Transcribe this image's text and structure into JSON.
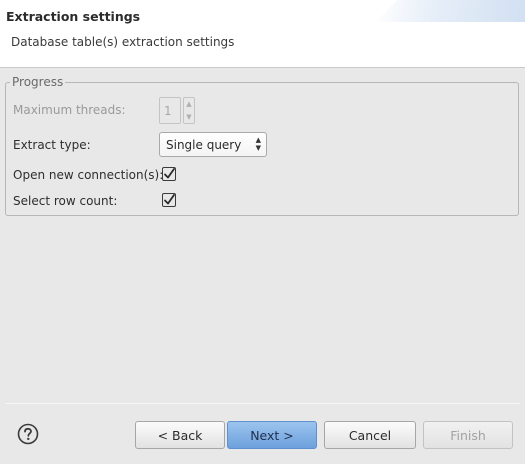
{
  "header": {
    "title": "Extraction settings",
    "description": "Database table(s) extraction settings"
  },
  "progress": {
    "legend": "Progress",
    "max_threads_label": "Maximum threads:",
    "max_threads_value": "1",
    "max_threads_enabled": false,
    "extract_type_label": "Extract type:",
    "extract_type_value": "Single query",
    "open_new_connections_label": "Open new connection(s):",
    "open_new_connections_checked": true,
    "select_row_count_label": "Select row count:",
    "select_row_count_checked": true
  },
  "footer": {
    "help_icon": "help-icon",
    "back_label": "< Back",
    "next_label": "Next >",
    "cancel_label": "Cancel",
    "finish_label": "Finish",
    "finish_enabled": false
  },
  "colors": {
    "accent": "#6da0dd",
    "background": "#e8e8e8"
  }
}
